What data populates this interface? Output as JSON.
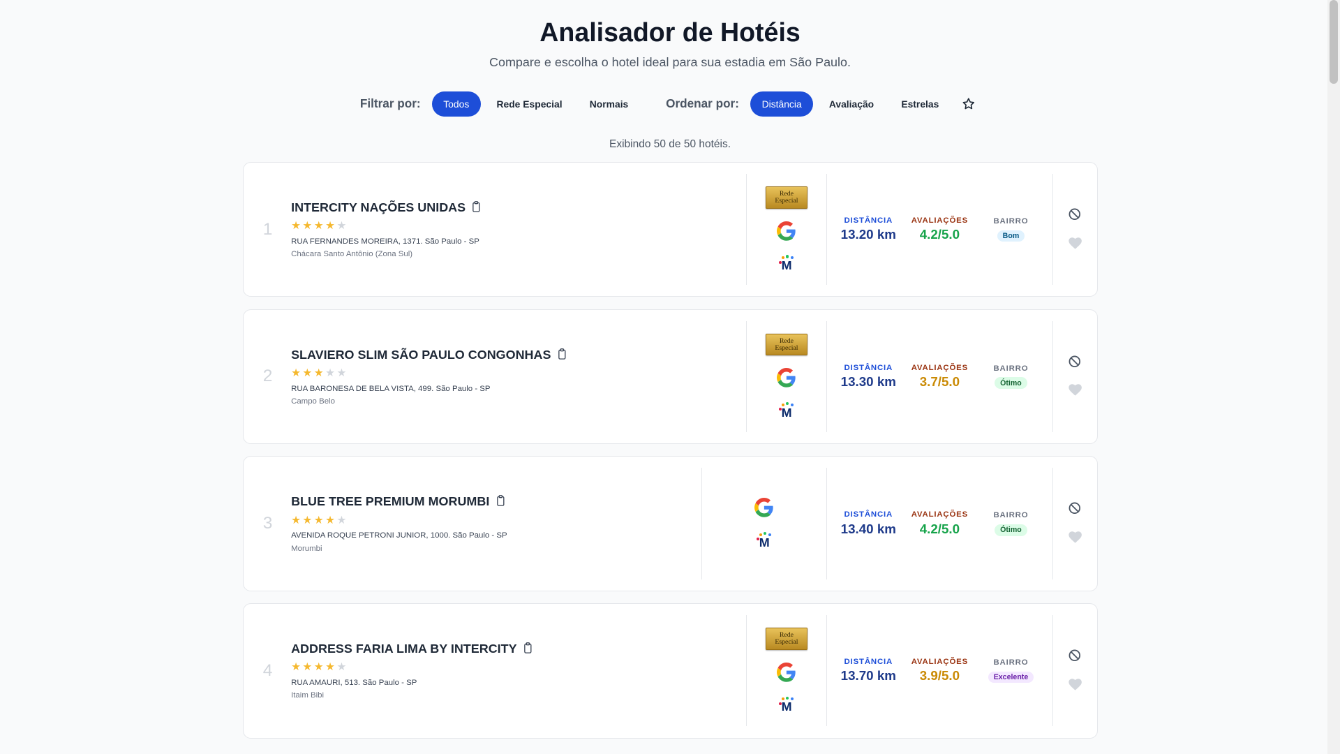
{
  "header": {
    "title": "Analisador de Hotéis",
    "subtitle": "Compare e escolha o hotel ideal para sua estadia em São Paulo."
  },
  "filters": {
    "label": "Filtrar por:",
    "options": [
      "Todos",
      "Rede Especial",
      "Normais"
    ],
    "active": "Todos"
  },
  "sort": {
    "label": "Ordenar por:",
    "options": [
      "Distância",
      "Avaliação",
      "Estrelas"
    ],
    "active": "Distância"
  },
  "favorites_filter_icon": "star-outline-icon",
  "count_text": "Exibindo 50 de 50 hotéis.",
  "metric_labels": {
    "distance": "DISTÂNCIA",
    "rating": "AVALIAÇÕES",
    "bairro": "BAIRRO"
  },
  "rede_badge_text": [
    "Rede",
    "Especial"
  ],
  "colors": {
    "accent": "#1d4ed8",
    "rating_good": "#16a34a",
    "rating_mid": "#ca8a04",
    "star": "#f5b82e"
  },
  "hotels": [
    {
      "rank": "1",
      "name": "INTERCITY NAÇÕES UNIDAS",
      "stars": 4,
      "address": "RUA FERNANDES MOREIRA, 1371. São Paulo - SP",
      "neighborhood": "Chácara Santo Antônio (Zona Sul)",
      "rede_especial": true,
      "distance": "13.20 km",
      "rating": "4.2/5.0",
      "rating_color": "#16a34a",
      "bairro_quality": "Bom",
      "bairro_pill_bg": "#e0f2fe",
      "bairro_pill_fg": "#075985"
    },
    {
      "rank": "2",
      "name": "SLAVIERO SLIM SÃO PAULO CONGONHAS",
      "stars": 3,
      "address": "RUA BARONESA DE BELA VISTA, 499. São Paulo - SP",
      "neighborhood": "Campo Belo",
      "rede_especial": true,
      "distance": "13.30 km",
      "rating": "3.7/5.0",
      "rating_color": "#ca8a04",
      "bairro_quality": "Ótimo",
      "bairro_pill_bg": "#dcfce7",
      "bairro_pill_fg": "#166534"
    },
    {
      "rank": "3",
      "name": "BLUE TREE PREMIUM MORUMBI",
      "stars": 4,
      "address": "AVENIDA ROQUE PETRONI JUNIOR, 1000. São Paulo - SP",
      "neighborhood": "Morumbi",
      "rede_especial": false,
      "distance": "13.40 km",
      "rating": "4.2/5.0",
      "rating_color": "#16a34a",
      "bairro_quality": "Ótimo",
      "bairro_pill_bg": "#dcfce7",
      "bairro_pill_fg": "#166534"
    },
    {
      "rank": "4",
      "name": "ADDRESS FARIA LIMA BY INTERCITY",
      "stars": 4,
      "address": "RUA AMAURI, 513. São Paulo - SP",
      "neighborhood": "Itaim Bibi",
      "rede_especial": true,
      "distance": "13.70 km",
      "rating": "3.9/5.0",
      "rating_color": "#ca8a04",
      "bairro_quality": "Excelente",
      "bairro_pill_bg": "#f3e8ff",
      "bairro_pill_fg": "#6b21a8"
    }
  ]
}
